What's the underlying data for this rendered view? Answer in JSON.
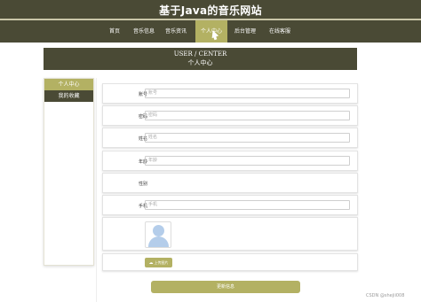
{
  "site": {
    "title": "基于Java的音乐网站"
  },
  "nav": {
    "items": [
      {
        "label": "首页"
      },
      {
        "label": "音乐信息"
      },
      {
        "label": "音乐资讯"
      },
      {
        "label": "个人中心",
        "active": true
      },
      {
        "label": "后台管理"
      },
      {
        "label": "在线客服"
      }
    ]
  },
  "header": {
    "en": "USER / CENTER",
    "cn": "个人中心"
  },
  "sidebar": {
    "items": [
      {
        "label": "个人中心",
        "active": true
      },
      {
        "label": "我的收藏"
      }
    ]
  },
  "form": {
    "account": {
      "label": "账号",
      "placeholder": "账号"
    },
    "password": {
      "label": "密码",
      "placeholder": "密码"
    },
    "name": {
      "label": "姓名",
      "placeholder": "姓名"
    },
    "age": {
      "label": "年龄",
      "placeholder": "年龄"
    },
    "gender": {
      "label": "性别"
    },
    "phone": {
      "label": "手机",
      "placeholder": "手机"
    },
    "avatar_icon": "user-avatar-placeholder",
    "upload_label": "上传图片",
    "upload_icon": "cloud-upload-icon",
    "submit_label": "更新信息"
  },
  "watermark": "CSDN @shejii008",
  "colors": {
    "dark": "#4a4a35",
    "accent": "#b3b163"
  }
}
